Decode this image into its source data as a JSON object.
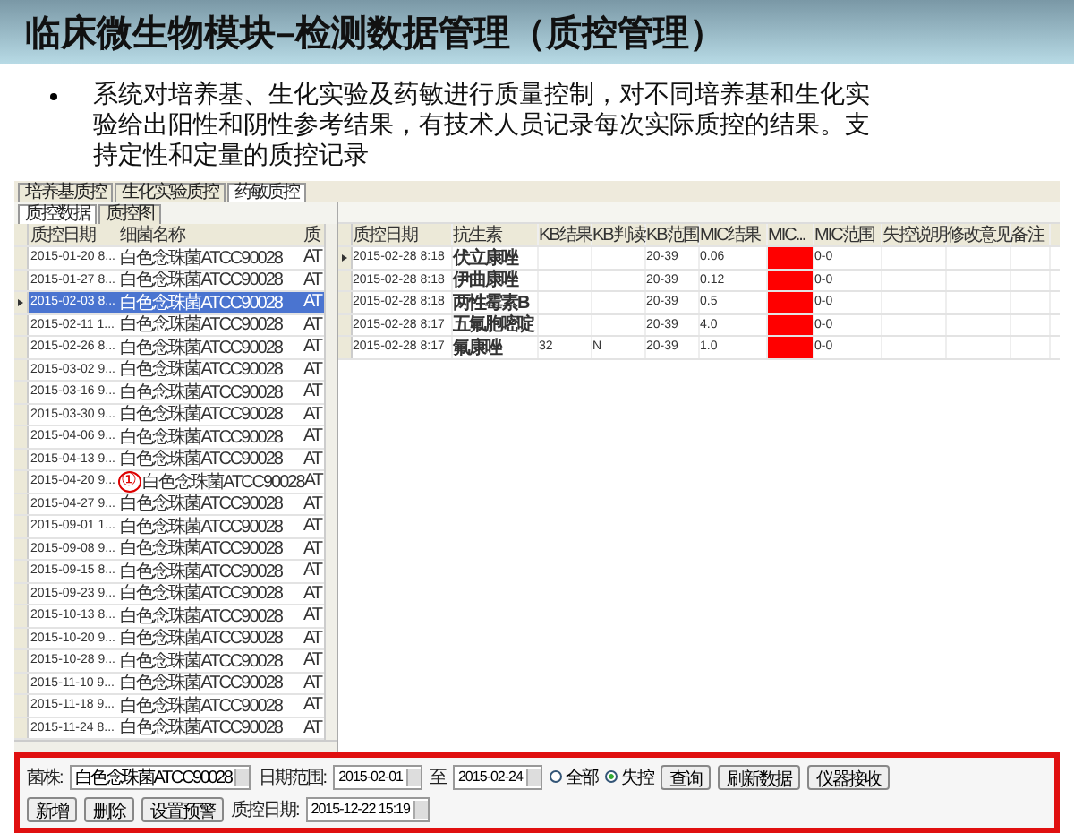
{
  "slide_title": "临床微生物模块–检测数据管理（质控管理）",
  "bullet": "系统对培养基、生化实验及药敏进行质量控制，对不同培养基和生化实验给出阳性和阴性参考结果，有技术人员记录每次实际质控的结果。支持定性和定量的质控记录",
  "app": {
    "tabs": [
      {
        "label": "培养基质控",
        "selected": false
      },
      {
        "label": "生化实验质控",
        "selected": false
      },
      {
        "label": "药敏质控",
        "selected": true
      }
    ],
    "subtabs": [
      {
        "label": "质控数据",
        "selected": true
      },
      {
        "label": "质控图",
        "selected": false
      }
    ],
    "left_table": {
      "columns": [
        "质控日期",
        "细菌名称",
        "质"
      ],
      "rows": [
        {
          "cells": [
            "2015-01-20 8...",
            "白色念珠菌ATCC90028",
            "AT"
          ],
          "selected": false
        },
        {
          "cells": [
            "2015-01-27 8...",
            "白色念珠菌ATCC90028",
            "AT"
          ],
          "selected": false
        },
        {
          "cells": [
            "2015-02-03 8...",
            "白色念珠菌ATCC90028",
            "AT"
          ],
          "selected": true
        },
        {
          "cells": [
            "2015-02-11 1...",
            "白色念珠菌ATCC90028",
            "AT"
          ],
          "selected": false
        },
        {
          "cells": [
            "2015-02-26 8...",
            "白色念珠菌ATCC90028",
            "AT"
          ],
          "selected": false
        },
        {
          "cells": [
            "2015-03-02 9...",
            "白色念珠菌ATCC90028",
            "AT"
          ],
          "selected": false
        },
        {
          "cells": [
            "2015-03-16 9...",
            "白色念珠菌ATCC90028",
            "AT"
          ],
          "selected": false
        },
        {
          "cells": [
            "2015-03-30 9...",
            "白色念珠菌ATCC90028",
            "AT"
          ],
          "selected": false
        },
        {
          "cells": [
            "2015-04-06 9...",
            "白色念珠菌ATCC90028",
            "AT"
          ],
          "selected": false
        },
        {
          "cells": [
            "2015-04-13 9...",
            "白色念珠菌ATCC90028",
            "AT"
          ],
          "selected": false
        },
        {
          "cells": [
            "2015-04-20 9...",
            "白色念珠菌ATCC90028",
            "AT"
          ],
          "selected": false,
          "annotation": "①"
        },
        {
          "cells": [
            "2015-04-27 9...",
            "白色念珠菌ATCC90028",
            "AT"
          ],
          "selected": false
        },
        {
          "cells": [
            "2015-09-01 1...",
            "白色念珠菌ATCC90028",
            "AT"
          ],
          "selected": false
        },
        {
          "cells": [
            "2015-09-08 9...",
            "白色念珠菌ATCC90028",
            "AT"
          ],
          "selected": false
        },
        {
          "cells": [
            "2015-09-15 8...",
            "白色念珠菌ATCC90028",
            "AT"
          ],
          "selected": false
        },
        {
          "cells": [
            "2015-09-23 9...",
            "白色念珠菌ATCC90028",
            "AT"
          ],
          "selected": false
        },
        {
          "cells": [
            "2015-10-13 8...",
            "白色念珠菌ATCC90028",
            "AT"
          ],
          "selected": false
        },
        {
          "cells": [
            "2015-10-20 9...",
            "白色念珠菌ATCC90028",
            "AT"
          ],
          "selected": false
        },
        {
          "cells": [
            "2015-10-28 9...",
            "白色念珠菌ATCC90028",
            "AT"
          ],
          "selected": false
        },
        {
          "cells": [
            "2015-11-10 9...",
            "白色念珠菌ATCC90028",
            "AT"
          ],
          "selected": false
        },
        {
          "cells": [
            "2015-11-18 9...",
            "白色念珠菌ATCC90028",
            "AT"
          ],
          "selected": false
        },
        {
          "cells": [
            "2015-11-24 8...",
            "白色念珠菌ATCC90028",
            "AT"
          ],
          "selected": false
        }
      ]
    },
    "right_table": {
      "columns": [
        "质控日期",
        "抗生素",
        "KB结果",
        "KB判读",
        "KB范围",
        "MIC结果",
        "MIC...",
        "MIC范围",
        "失控说明",
        "修改意见",
        "备注"
      ],
      "rows": [
        {
          "selected": true,
          "date": "2015-02-28 8:18",
          "antibiotic": "伏立康唑",
          "kb_range": "20-39",
          "mic_result": "0.06",
          "alert": true,
          "mic_range": "0-0"
        },
        {
          "selected": false,
          "date": "2015-02-28 8:18",
          "antibiotic": "伊曲康唑",
          "kb_range": "20-39",
          "mic_result": "0.12",
          "alert": true,
          "mic_range": "0-0"
        },
        {
          "selected": false,
          "date": "2015-02-28 8:18",
          "antibiotic": "两性霉素B",
          "kb_range": "20-39",
          "mic_result": "0.5",
          "alert": true,
          "mic_range": "0-0"
        },
        {
          "selected": false,
          "date": "2015-02-28 8:17",
          "antibiotic": "五氟胞嘧啶",
          "kb_range": "20-39",
          "mic_result": "4.0",
          "alert": true,
          "mic_range": "0-0"
        },
        {
          "selected": false,
          "date": "2015-02-28 8:17",
          "antibiotic": "氟康唑",
          "kb_result": "32",
          "kb_judgement": "N",
          "kb_range": "20-39",
          "mic_result": "1.0",
          "alert": true,
          "mic_range": "0-0"
        }
      ]
    },
    "filter": {
      "strain_label": "菌株:",
      "strain": "白色念珠菌ATCC90028",
      "date_label": "日期范围:",
      "date_from": "2015-02-01",
      "to_label": "至",
      "date_to": "2015-02-24",
      "radios": [
        {
          "label": "全部",
          "selected": false
        },
        {
          "label": "失控",
          "selected": true
        }
      ],
      "buttons": [
        "查询",
        "刷新数据",
        "仪器接收"
      ]
    },
    "actions": {
      "buttons": [
        "新增",
        "删除",
        "设置预警"
      ],
      "qc_date_label": "质控日期:",
      "qc_date": "2015-12-22 15:19"
    }
  }
}
